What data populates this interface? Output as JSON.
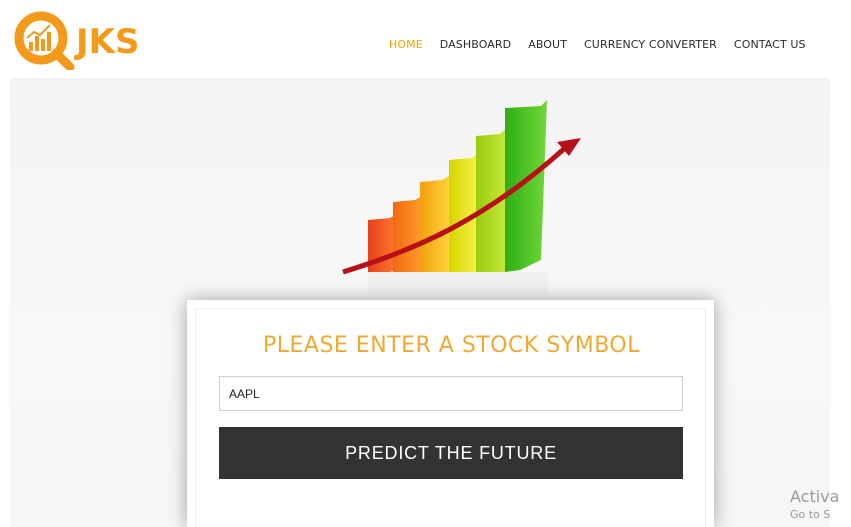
{
  "logo": {
    "text": "JKS",
    "icon": "magnifier-chart-icon",
    "color": "#f49a1a"
  },
  "nav": {
    "items": [
      {
        "label": "HOME",
        "active": true
      },
      {
        "label": "DASHBOARD",
        "active": false
      },
      {
        "label": "ABOUT",
        "active": false
      },
      {
        "label": "CURRENCY CONVERTER",
        "active": false
      },
      {
        "label": "CONTACT US",
        "active": false
      }
    ],
    "active_color": "#f0a500"
  },
  "hero": {
    "image": "rising-bar-chart-arrow-illustration"
  },
  "form": {
    "title": "PLEASE ENTER A STOCK SYMBOL",
    "title_color": "#f0a830",
    "symbol_value": "AAPL",
    "button_label": "PREDICT THE FUTURE",
    "button_color": "#333333"
  },
  "watermark": {
    "line1": "Activa",
    "line2": "Go to S"
  }
}
